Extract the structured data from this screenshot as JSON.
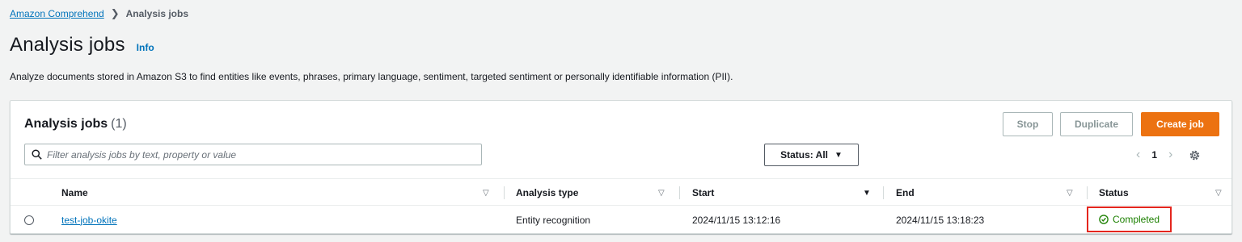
{
  "breadcrumb": {
    "parent": "Amazon Comprehend",
    "current": "Analysis jobs"
  },
  "page": {
    "title": "Analysis jobs",
    "info_label": "Info",
    "description": "Analyze documents stored in Amazon S3 to find entities like events, phrases, primary language, sentiment, targeted sentiment or personally identifiable information (PII)."
  },
  "panel": {
    "title": "Analysis jobs",
    "count": "(1)",
    "buttons": {
      "stop": "Stop",
      "duplicate": "Duplicate",
      "create": "Create job"
    },
    "search_placeholder": "Filter analysis jobs by text, property or value",
    "status_filter": "Status: All",
    "pagination": {
      "current_page": "1"
    }
  },
  "table": {
    "columns": [
      "Name",
      "Analysis type",
      "Start",
      "End",
      "Status"
    ],
    "rows": [
      {
        "name": "test-job-okite",
        "analysis_type": "Entity recognition",
        "start": "2024/11/15 13:12:16",
        "end": "2024/11/15 13:18:23",
        "status": "Completed"
      }
    ]
  },
  "colors": {
    "link": "#0073bb",
    "primary_button": "#ec7211",
    "success": "#1d8102",
    "highlight_border": "#e4261e"
  },
  "icons": {
    "search": "search-icon",
    "settings": "gear-icon",
    "status": "check-circle-icon"
  }
}
